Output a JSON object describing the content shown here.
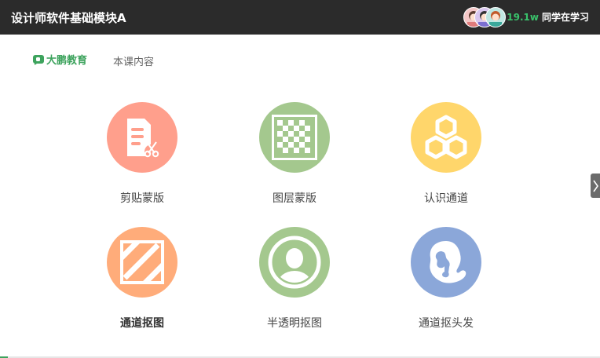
{
  "header": {
    "title": "设计师软件基础模块A",
    "learner_count": "19.1w",
    "learner_label": "同学在学习"
  },
  "subnav": {
    "brand": "大鹏教育",
    "tab": "本课内容"
  },
  "lessons": [
    {
      "label": "剪贴蒙版",
      "icon": "document-scissors-icon",
      "color": "#ff9f8c"
    },
    {
      "label": "图层蒙版",
      "icon": "checkerboard-icon",
      "color": "#a4c88e"
    },
    {
      "label": "认识通道",
      "icon": "hexagons-icon",
      "color": "#ffd66b"
    },
    {
      "label": "通道抠图",
      "icon": "diagonal-stripes-icon",
      "color": "#ffac7a"
    },
    {
      "label": "半透明抠图",
      "icon": "person-portrait-icon",
      "color": "#a4c88e"
    },
    {
      "label": "通道抠头发",
      "icon": "head-hair-icon",
      "color": "#8ba7d9"
    }
  ],
  "progress": 0.013,
  "colors": {
    "accent": "#3da35d",
    "topbar": "#2b2b2b"
  }
}
